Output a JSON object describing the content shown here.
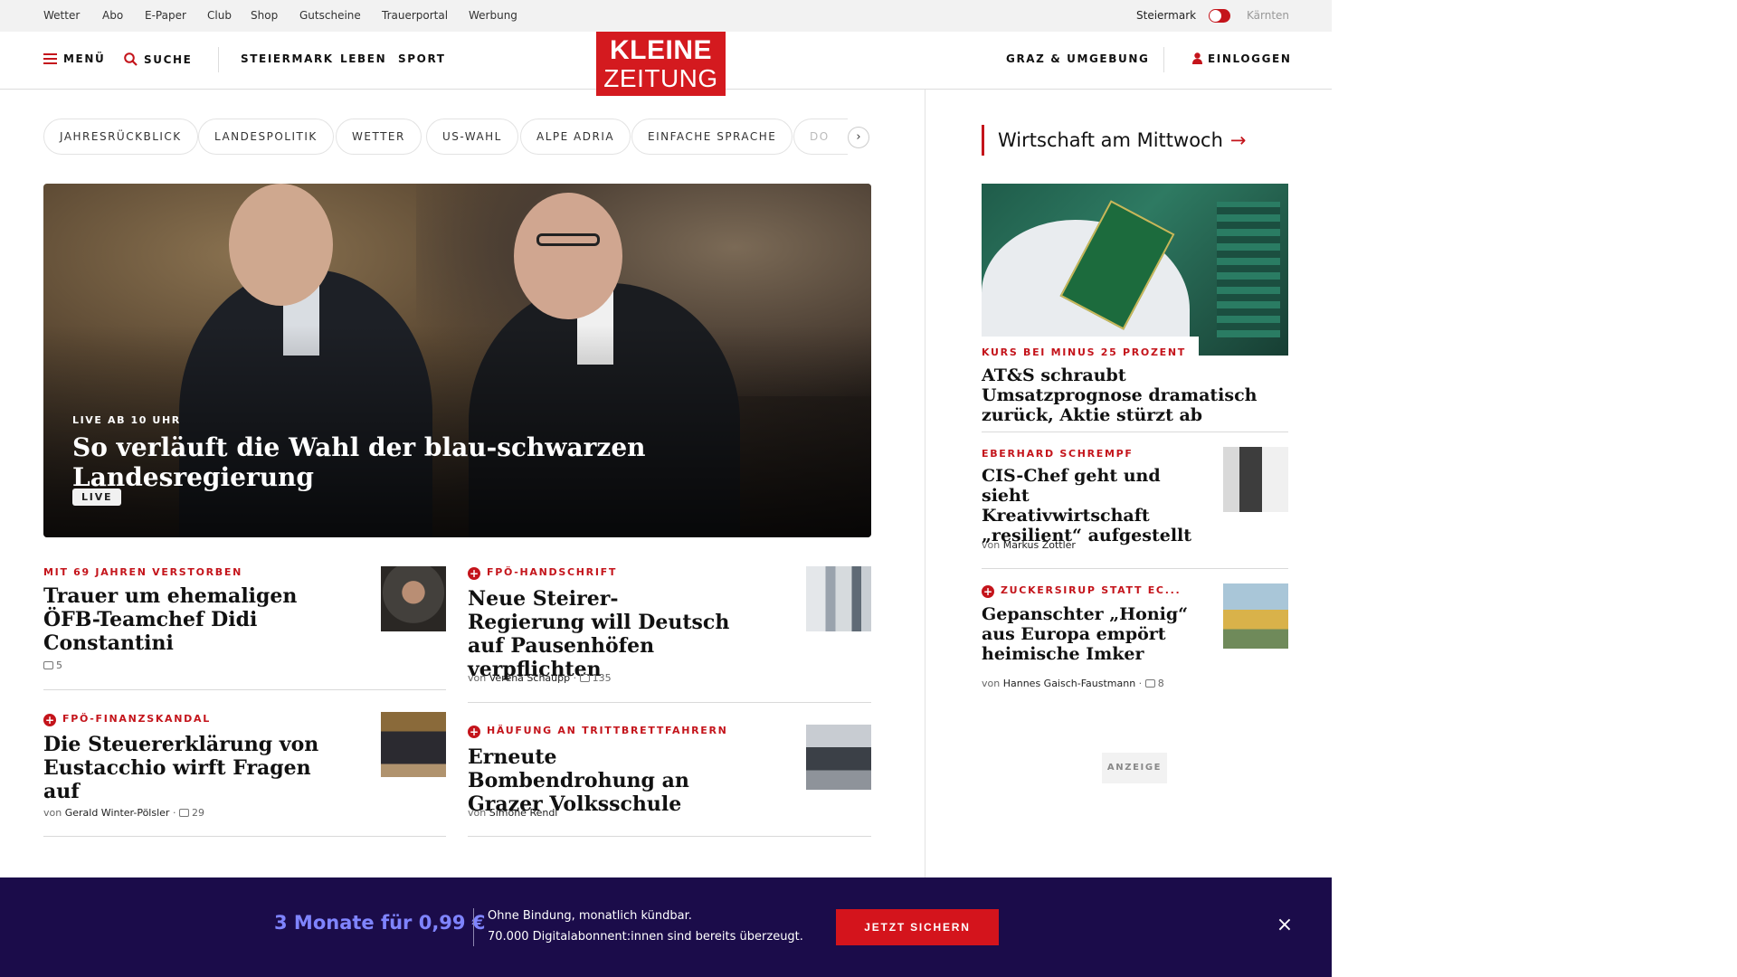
{
  "util_links": [
    "Wetter",
    "Abo",
    "E-Paper",
    "Club",
    "Shop",
    "Gutscheine",
    "Trauerportal",
    "Werbung"
  ],
  "regions": {
    "active": "Steiermark",
    "inactive": "Kärnten"
  },
  "header": {
    "menu_label": "MENÜ",
    "search_label": "SUCHE",
    "nav": [
      "STEIERMARK",
      "LEBEN",
      "SPORT"
    ],
    "logo_line1": "KLEINE",
    "logo_line2": "ZEITUNG",
    "local_label": "GRAZ & UMGEBUNG",
    "login_label": "EINLOGGEN"
  },
  "tags": [
    "JAHRESRÜCKBLICK",
    "LANDESPOLITIK",
    "WETTER",
    "US-WAHL",
    "ALPE ADRIA",
    "EINFACHE SPRACHE",
    "DO"
  ],
  "tags_next": "›",
  "hero": {
    "kicker": "LIVE AB 10 UHR",
    "title": "So verläuft die Wahl der blau-schwarzen Landesregierung",
    "badge": "LIVE"
  },
  "teasers": [
    {
      "kicker": "MIT 69 JAHREN VERSTORBEN",
      "plus": false,
      "title": "Trauer um ehemaligen ÖFB-Teamchef Didi Constantini",
      "author": "",
      "comments": "5"
    },
    {
      "kicker": "FPÖ-HANDSCHRIFT",
      "plus": true,
      "title": "Neue Steirer-Regierung will Deutsch auf Pausenhöfen verpflichten",
      "author": "Verena Schaupp",
      "comments": "135"
    },
    {
      "kicker": "FPÖ-FINANZSKANDAL",
      "plus": true,
      "title": "Die Steuererklärung von Eustacchio wirft Fragen auf",
      "author": "Gerald Winter-Pölsler",
      "comments": "29"
    },
    {
      "kicker": "HÄUFUNG AN TRITTBRETTFAHRERN",
      "plus": true,
      "title": "Erneute Bombendrohung an Grazer Volksschule",
      "author": "Simone Rendl",
      "comments": ""
    }
  ],
  "meta_von": "von",
  "sidebar": {
    "heading": "Wirtschaft am Mittwoch",
    "heading_arrow": "→",
    "lead": {
      "kicker": "KURS BEI MINUS 25 PROZENT",
      "title": "AT&S schraubt Umsatzprognose dramatisch zurück, Aktie stürzt ab"
    },
    "items": [
      {
        "kicker": "EBERHARD SCHREMPF",
        "plus": false,
        "title": "CIS-Chef geht und sieht Kreativwirtschaft „resilient“ aufgestellt",
        "author": "Markus Zottler",
        "comments": ""
      },
      {
        "kicker": "ZUCKERSIRUP STATT EC...",
        "plus": true,
        "title": "Gepanschter „Honig“ aus Europa empört heimische Imker",
        "author": "Hannes Gaisch-Faustmann",
        "comments": "8"
      }
    ],
    "ad_label": "ANZEIGE"
  },
  "banner": {
    "offer": "3 Monate für 0,99 €",
    "line1": "Ohne Bindung, monatlich kündbar.",
    "line2": "70.000 Digitalabonnent:innen sind bereits überzeugt.",
    "cta": "JETZT SICHERN",
    "close": "×"
  },
  "colors": {
    "brand_red": "#d41a1f",
    "banner_bg": "#1b0c4a",
    "banner_offer": "#7f84ff"
  }
}
